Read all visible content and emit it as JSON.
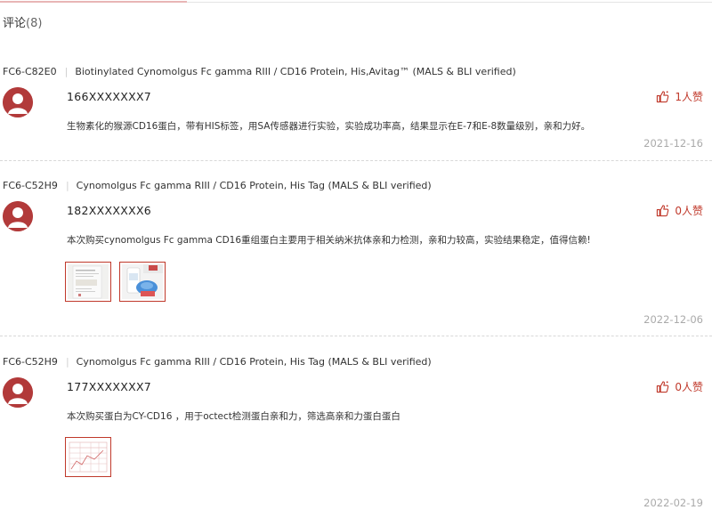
{
  "section": {
    "title": "评论",
    "count": "(8)"
  },
  "colors": {
    "accent": "#c0392b",
    "avatar": "#b23a3a",
    "date": "#aaaaaa"
  },
  "reviews": [
    {
      "sku": "FC6-C82E0",
      "product": "Biotinylated Cynomolgus Fc gamma RIII / CD16 Protein, His,Avitag™ (MALS & BLI verified)",
      "user": "166XXXXXXX7",
      "comment": "生物素化的猴源CD16蛋白，带有HIS标签，用SA传感器进行实验，实验成功率高，结果显示在E-7和E-8数量级别，亲和力好。",
      "likes": "1人赞",
      "date": "2021-12-16",
      "like_icon": "thumbs-up-icon"
    },
    {
      "sku": "FC6-C52H9",
      "product": "Cynomolgus Fc gamma RIII / CD16 Protein, His Tag (MALS & BLI verified)",
      "user": "182XXXXXXX6",
      "comment": "本次购买cynomolgus Fc gamma CD16重组蛋白主要用于相关纳米抗体亲和力检测，亲和力较高，实验结果稳定，值得信赖!",
      "likes": "0人赞",
      "date": "2022-12-06",
      "like_icon": "thumbs-up-icon"
    },
    {
      "sku": "FC6-C52H9",
      "product": "Cynomolgus Fc gamma RIII / CD16 Protein, His Tag (MALS & BLI verified)",
      "user": "177XXXXXXX7",
      "comment": "本次购买蛋白为CY-CD16 ，用于octect检测蛋白亲和力，筛选高亲和力蛋白蛋白",
      "likes": "0人赞",
      "date": "2022-02-19",
      "like_icon": "thumbs-up-icon"
    }
  ]
}
